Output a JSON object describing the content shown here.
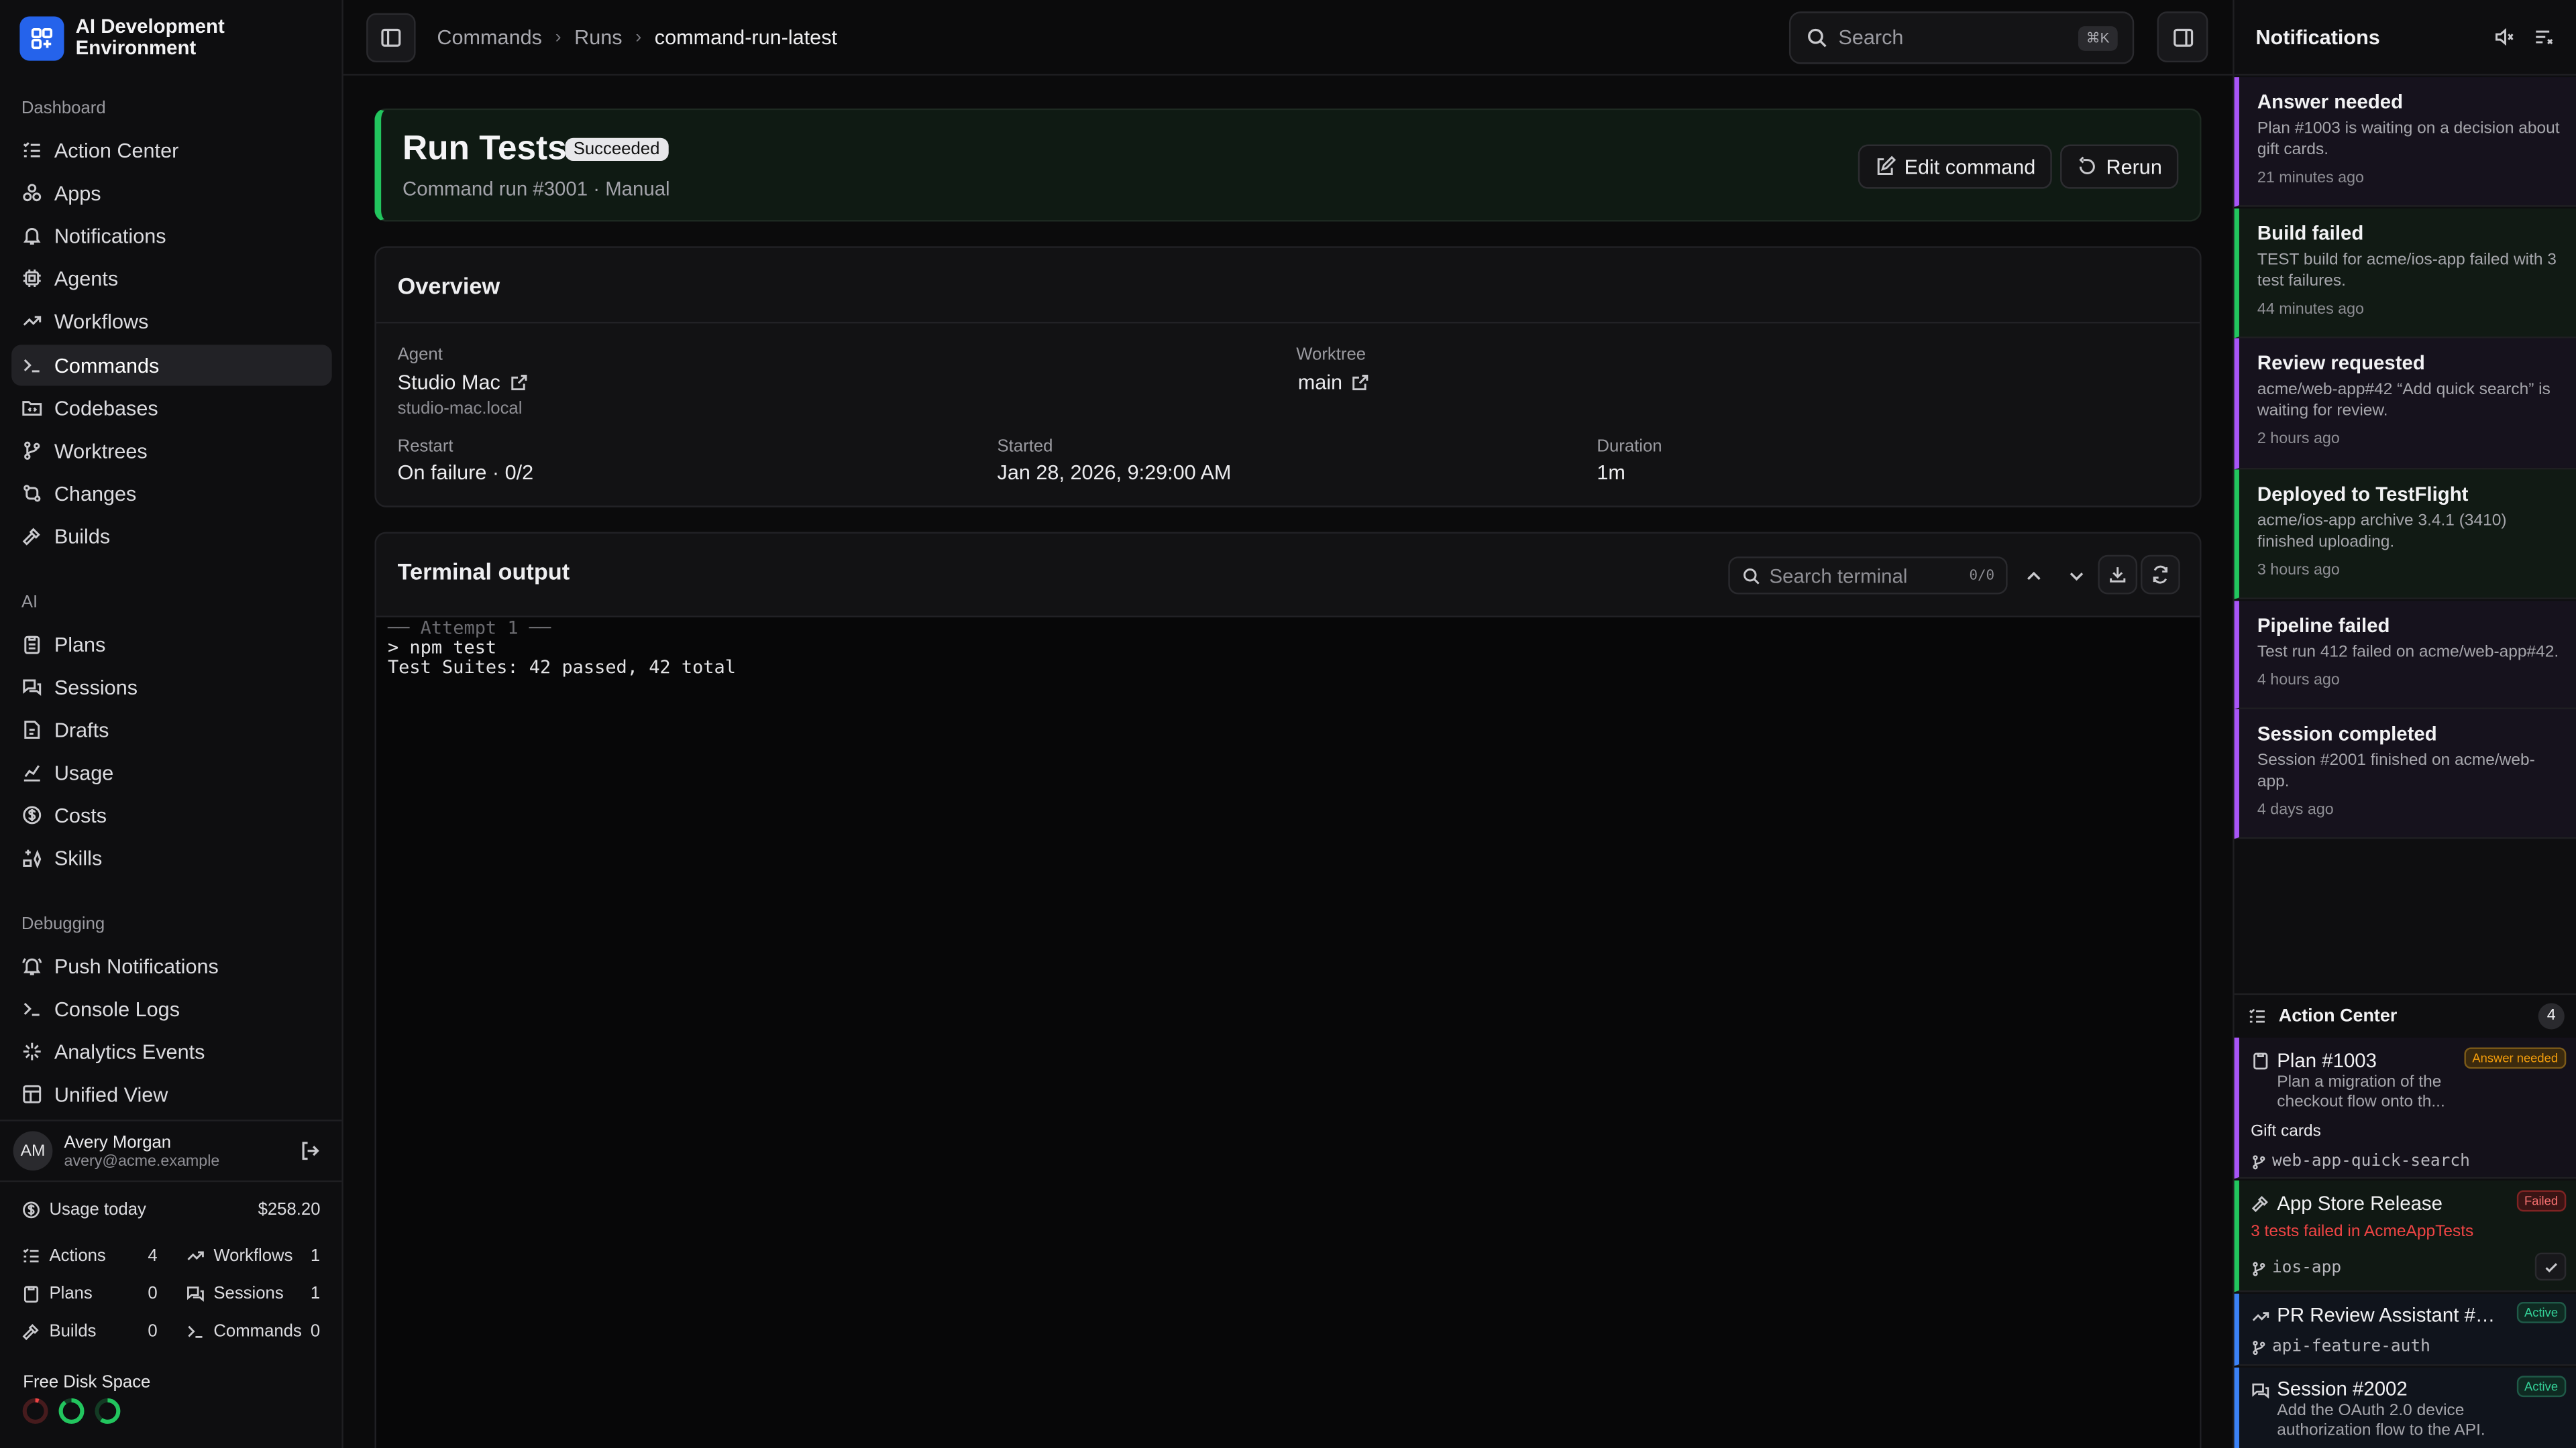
{
  "app": {
    "title": "AI Development Environment"
  },
  "sidebar": {
    "dashboard_label": "Dashboard",
    "dashboard_items": [
      {
        "label": "Action Center",
        "icon": "list-check-icon"
      },
      {
        "label": "Apps",
        "icon": "apps-icon"
      },
      {
        "label": "Notifications",
        "icon": "bell-icon"
      },
      {
        "label": "Agents",
        "icon": "cpu-icon"
      },
      {
        "label": "Workflows",
        "icon": "workflow-icon"
      },
      {
        "label": "Commands",
        "icon": "terminal-icon",
        "active": true
      },
      {
        "label": "Codebases",
        "icon": "folder-code-icon"
      },
      {
        "label": "Worktrees",
        "icon": "git-branch-icon"
      },
      {
        "label": "Changes",
        "icon": "git-compare-icon"
      },
      {
        "label": "Builds",
        "icon": "hammer-icon"
      }
    ],
    "ai_label": "AI",
    "ai_items": [
      {
        "label": "Plans",
        "icon": "clipboard-icon"
      },
      {
        "label": "Sessions",
        "icon": "chat-icon"
      },
      {
        "label": "Drafts",
        "icon": "draft-icon"
      },
      {
        "label": "Usage",
        "icon": "chart-icon"
      },
      {
        "label": "Costs",
        "icon": "dollar-icon"
      },
      {
        "label": "Skills",
        "icon": "skills-icon"
      }
    ],
    "debug_label": "Debugging",
    "debug_items": [
      {
        "label": "Push Notifications",
        "icon": "bell-ring-icon"
      },
      {
        "label": "Console Logs",
        "icon": "terminal-icon"
      },
      {
        "label": "Analytics Events",
        "icon": "sparkle-icon"
      },
      {
        "label": "Unified View",
        "icon": "layout-icon"
      }
    ],
    "user": {
      "initials": "AM",
      "name": "Avery Morgan",
      "email": "avery@acme.example"
    },
    "usage": {
      "label": "Usage today",
      "amount": "$258.20",
      "stats": [
        {
          "label": "Actions",
          "value": "4"
        },
        {
          "label": "Workflows",
          "value": "1"
        },
        {
          "label": "Plans",
          "value": "0"
        },
        {
          "label": "Sessions",
          "value": "1"
        },
        {
          "label": "Builds",
          "value": "0"
        },
        {
          "label": "Commands",
          "value": "0"
        }
      ]
    },
    "disk": {
      "label": "Free Disk Space",
      "rings": [
        {
          "color": "#ef4444",
          "fraction": 0.05
        },
        {
          "color": "#22c55e",
          "fraction": 0.9
        },
        {
          "color": "#22c55e",
          "fraction": 0.6
        }
      ]
    }
  },
  "topbar": {
    "breadcrumbs": [
      "Commands",
      "Runs",
      "command-run-latest"
    ],
    "search_placeholder": "Search",
    "search_shortcut": "⌘K"
  },
  "run": {
    "title": "Run Tests",
    "status": "Succeeded",
    "subtitle": "Command run #3001 · Manual",
    "edit_label": "Edit command",
    "rerun_label": "Rerun"
  },
  "overview": {
    "title": "Overview",
    "agent_label": "Agent",
    "agent_value": "Studio Mac",
    "agent_host": "studio-mac.local",
    "worktree_label": "Worktree",
    "worktree_value": "main",
    "restart_label": "Restart",
    "restart_value": "On failure · 0/2",
    "started_label": "Started",
    "started_value": "Jan 28, 2026, 9:29:00 AM",
    "duration_label": "Duration",
    "duration_value": "1m"
  },
  "terminal": {
    "title": "Terminal output",
    "search_placeholder": "Search terminal",
    "match_count": "0/0",
    "lines": [
      "── Attempt 1 ──",
      "> npm test",
      "Test Suites: 42 passed, 42 total"
    ]
  },
  "notifications": {
    "title": "Notifications",
    "items": [
      {
        "title": "Answer needed",
        "body": "Plan #1003 is waiting on a decision about gift cards.",
        "time": "21 minutes ago",
        "color": "#a855f7"
      },
      {
        "title": "Build failed",
        "body": "TEST build for acme/ios-app failed with 3 test failures.",
        "time": "44 minutes ago",
        "color": "#22c55e"
      },
      {
        "title": "Review requested",
        "body": "acme/web-app#42 “Add quick search” is waiting for review.",
        "time": "2 hours ago",
        "color": "#a855f7"
      },
      {
        "title": "Deployed to TestFlight",
        "body": "acme/ios-app archive 3.4.1 (3410) finished uploading.",
        "time": "3 hours ago",
        "color": "#22c55e"
      },
      {
        "title": "Pipeline failed",
        "body": "Test run 412 failed on acme/web-app#42.",
        "time": "4 hours ago",
        "color": "#a855f7"
      },
      {
        "title": "Session completed",
        "body": "Session #2001 finished on acme/web-app.",
        "time": "4 days ago",
        "color": "#a855f7"
      }
    ]
  },
  "action_center": {
    "title": "Action Center",
    "count": "4",
    "items": [
      {
        "title": "Plan #1003",
        "badge": "Answer needed",
        "desc": "Plan a migration of the checkout flow onto th...",
        "extra": "Gift cards",
        "branch": "web-app-quick-search",
        "color": "#a855f7"
      },
      {
        "title": "App Store Release",
        "badge": "Failed",
        "desc": "3 tests failed in AcmeAppTests",
        "branch": "ios-app",
        "color": "#22c55e"
      },
      {
        "title": "PR Review Assistant #4...",
        "badge": "Active",
        "branch": "api-feature-auth",
        "color": "#3b82f6"
      },
      {
        "title": "Session #2002",
        "badge": "Active",
        "desc": "Add the OAuth 2.0 device authorization flow to the API.",
        "color": "#3b82f6"
      }
    ]
  }
}
